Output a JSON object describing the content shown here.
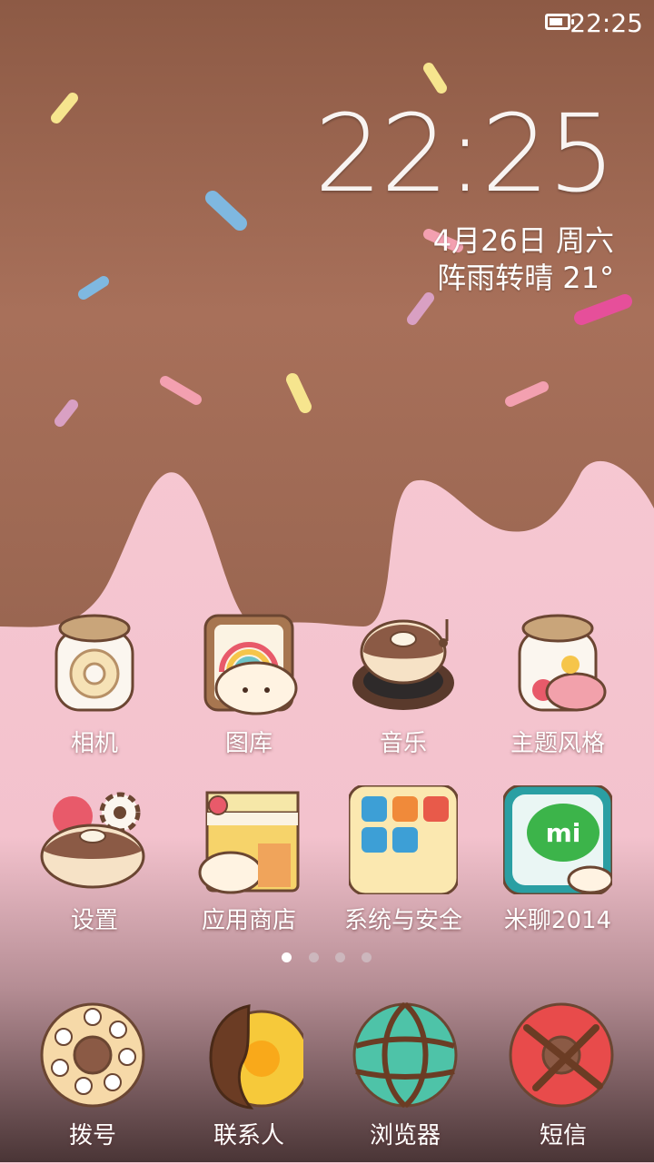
{
  "status_bar": {
    "time": "22:25",
    "battery_level": 0.8,
    "battery_icon": "battery-icon"
  },
  "clock_widget": {
    "time": "22:25",
    "date": "4月26日 周六",
    "weather": "阵雨转晴  21°"
  },
  "apps": [
    {
      "id": "camera",
      "label": "相机",
      "icon": "camera-jar-icon"
    },
    {
      "id": "gallery",
      "label": "图库",
      "icon": "gallery-icon"
    },
    {
      "id": "music",
      "label": "音乐",
      "icon": "music-icon"
    },
    {
      "id": "themes",
      "label": "主题风格",
      "icon": "themes-jar-icon"
    },
    {
      "id": "settings",
      "label": "设置",
      "icon": "settings-gear-icon"
    },
    {
      "id": "appstore",
      "label": "应用商店",
      "icon": "app-store-icon"
    },
    {
      "id": "system",
      "label": "系统与安全",
      "icon": "system-folder-icon"
    },
    {
      "id": "mitalk",
      "label": "米聊2014",
      "icon": "mitalk-icon"
    }
  ],
  "page_indicator": {
    "count": 4,
    "active": 0
  },
  "dock": [
    {
      "id": "dialer",
      "label": "拨号",
      "icon": "dialer-donut-icon"
    },
    {
      "id": "contacts",
      "label": "联系人",
      "icon": "contacts-donut-icon"
    },
    {
      "id": "browser",
      "label": "浏览器",
      "icon": "browser-donut-icon"
    },
    {
      "id": "messages",
      "label": "短信",
      "icon": "messages-donut-icon"
    }
  ],
  "colors": {
    "chocolate": "#a0684f",
    "pink": "#f7c9d3",
    "frosting": "#f3dcb8"
  }
}
